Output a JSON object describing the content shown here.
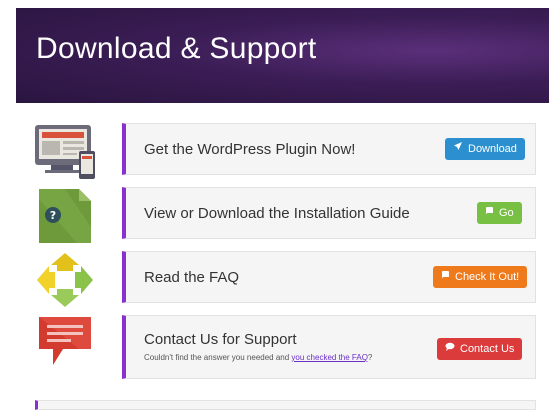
{
  "header": {
    "title": "Download & Support"
  },
  "items": [
    {
      "title": "Get the WordPress Plugin Now!",
      "button": {
        "label": "Download",
        "icon": "rocket-icon",
        "color": "#2b8fd0"
      },
      "icon": "devices-icon"
    },
    {
      "title": "View or Download the Installation Guide",
      "button": {
        "label": "Go",
        "icon": "book-icon",
        "color": "#78c043"
      },
      "icon": "document-help-icon"
    },
    {
      "title": "Read the FAQ",
      "button": {
        "label": "Check It Out!",
        "icon": "book-icon",
        "color": "#ef7a1c"
      },
      "icon": "recycle-arrows-icon"
    },
    {
      "title": "Contact Us for Support",
      "subtitle_prefix": "Couldn't find the answer you needed and ",
      "subtitle_link": "you checked the FAQ",
      "subtitle_suffix": "?",
      "button": {
        "label": "Contact Us",
        "icon": "chat-icon",
        "color": "#dc3b3b"
      },
      "icon": "speech-bubble-icon"
    }
  ]
}
